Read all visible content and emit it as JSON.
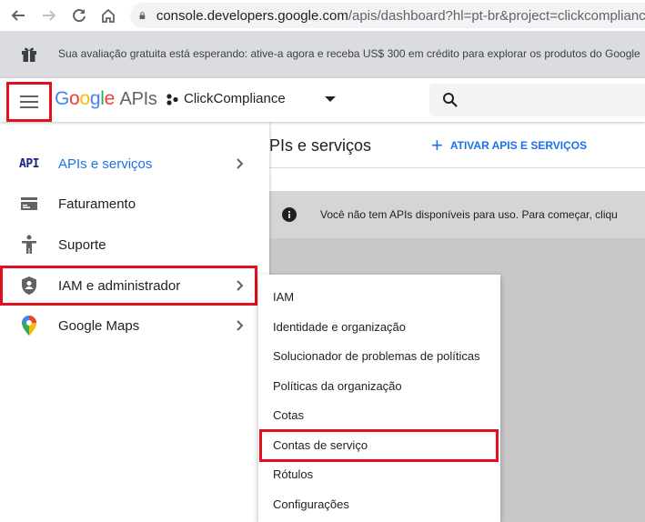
{
  "browser": {
    "url_host": "console.developers.google.com",
    "url_path": "/apis/dashboard?hl=pt-br&project=clickcompliance-",
    "icons": [
      "back-arrow-icon",
      "forward-arrow-icon",
      "reload-icon",
      "home-icon",
      "lock-icon"
    ]
  },
  "trial_banner": {
    "text": "Sua avaliação gratuita está esperando: ative-a agora e receba US$ 300 em crédito para explorar os produtos do Google",
    "icon": "gift-icon"
  },
  "header": {
    "logo_google": "Google",
    "logo_apis": "APIs",
    "project_name": "ClickCompliance",
    "colors": {
      "blue": "#4285F4",
      "red": "#EA4335",
      "yellow": "#FBBC05",
      "green": "#34A853"
    }
  },
  "content": {
    "page_title": "PIs e serviços",
    "enable_apis_label": "ATIVAR APIS E SERVIÇOS",
    "info_text": "Você não tem APIs disponíveis para uso. Para começar, cliqu"
  },
  "nav_menu": {
    "items": [
      {
        "label": "APIs e serviços",
        "icon": "api-icon",
        "has_chevron": true,
        "active": true
      },
      {
        "label": "Faturamento",
        "icon": "billing-icon",
        "has_chevron": false
      },
      {
        "label": "Suporte",
        "icon": "support-icon",
        "has_chevron": false
      },
      {
        "label": "IAM e administrador",
        "icon": "shield-icon",
        "has_chevron": true
      },
      {
        "label": "Google Maps",
        "icon": "maps-pin-icon",
        "has_chevron": true
      }
    ]
  },
  "submenu": {
    "items": [
      {
        "label": "IAM"
      },
      {
        "label": "Identidade e organização"
      },
      {
        "label": "Solucionador de problemas de políticas"
      },
      {
        "label": "Políticas da organização"
      },
      {
        "label": "Cotas"
      },
      {
        "label": "Contas de serviço"
      },
      {
        "label": "Rótulos"
      },
      {
        "label": "Configurações"
      }
    ]
  },
  "highlight_color": "#E0101E"
}
